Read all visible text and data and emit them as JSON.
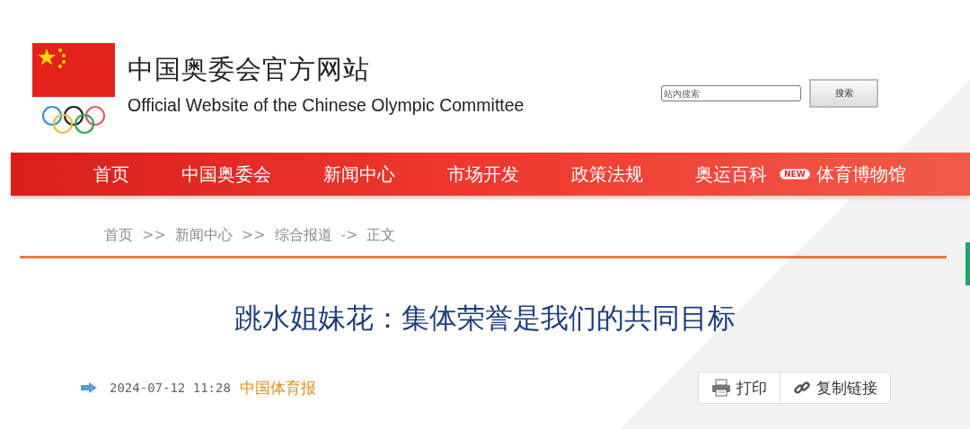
{
  "site": {
    "title": "中国奥委会官方网站",
    "subtitle": "Official Website of the Chinese Olympic Committee"
  },
  "search": {
    "placeholder": "站内搜索",
    "button": "搜索"
  },
  "nav": [
    {
      "label": "首页"
    },
    {
      "label": "中国奥委会"
    },
    {
      "label": "新闻中心"
    },
    {
      "label": "市场开发"
    },
    {
      "label": "政策法规"
    },
    {
      "label": "奥运百科"
    },
    {
      "label": "体育博物馆",
      "badge": "NEW"
    }
  ],
  "breadcrumb": [
    {
      "label": "首页",
      "sep": ">>"
    },
    {
      "label": "新闻中心",
      "sep": ">>"
    },
    {
      "label": "综合报道",
      "sep": "->"
    },
    {
      "label": "正文"
    }
  ],
  "article": {
    "headline": "跳水姐妹花：集体荣誉是我们的共同目标",
    "date": "2024-07-12 11:28",
    "source": "中国体育报"
  },
  "actions": [
    {
      "kind": "print",
      "label": "打印"
    },
    {
      "kind": "link",
      "label": "复制链接"
    }
  ]
}
